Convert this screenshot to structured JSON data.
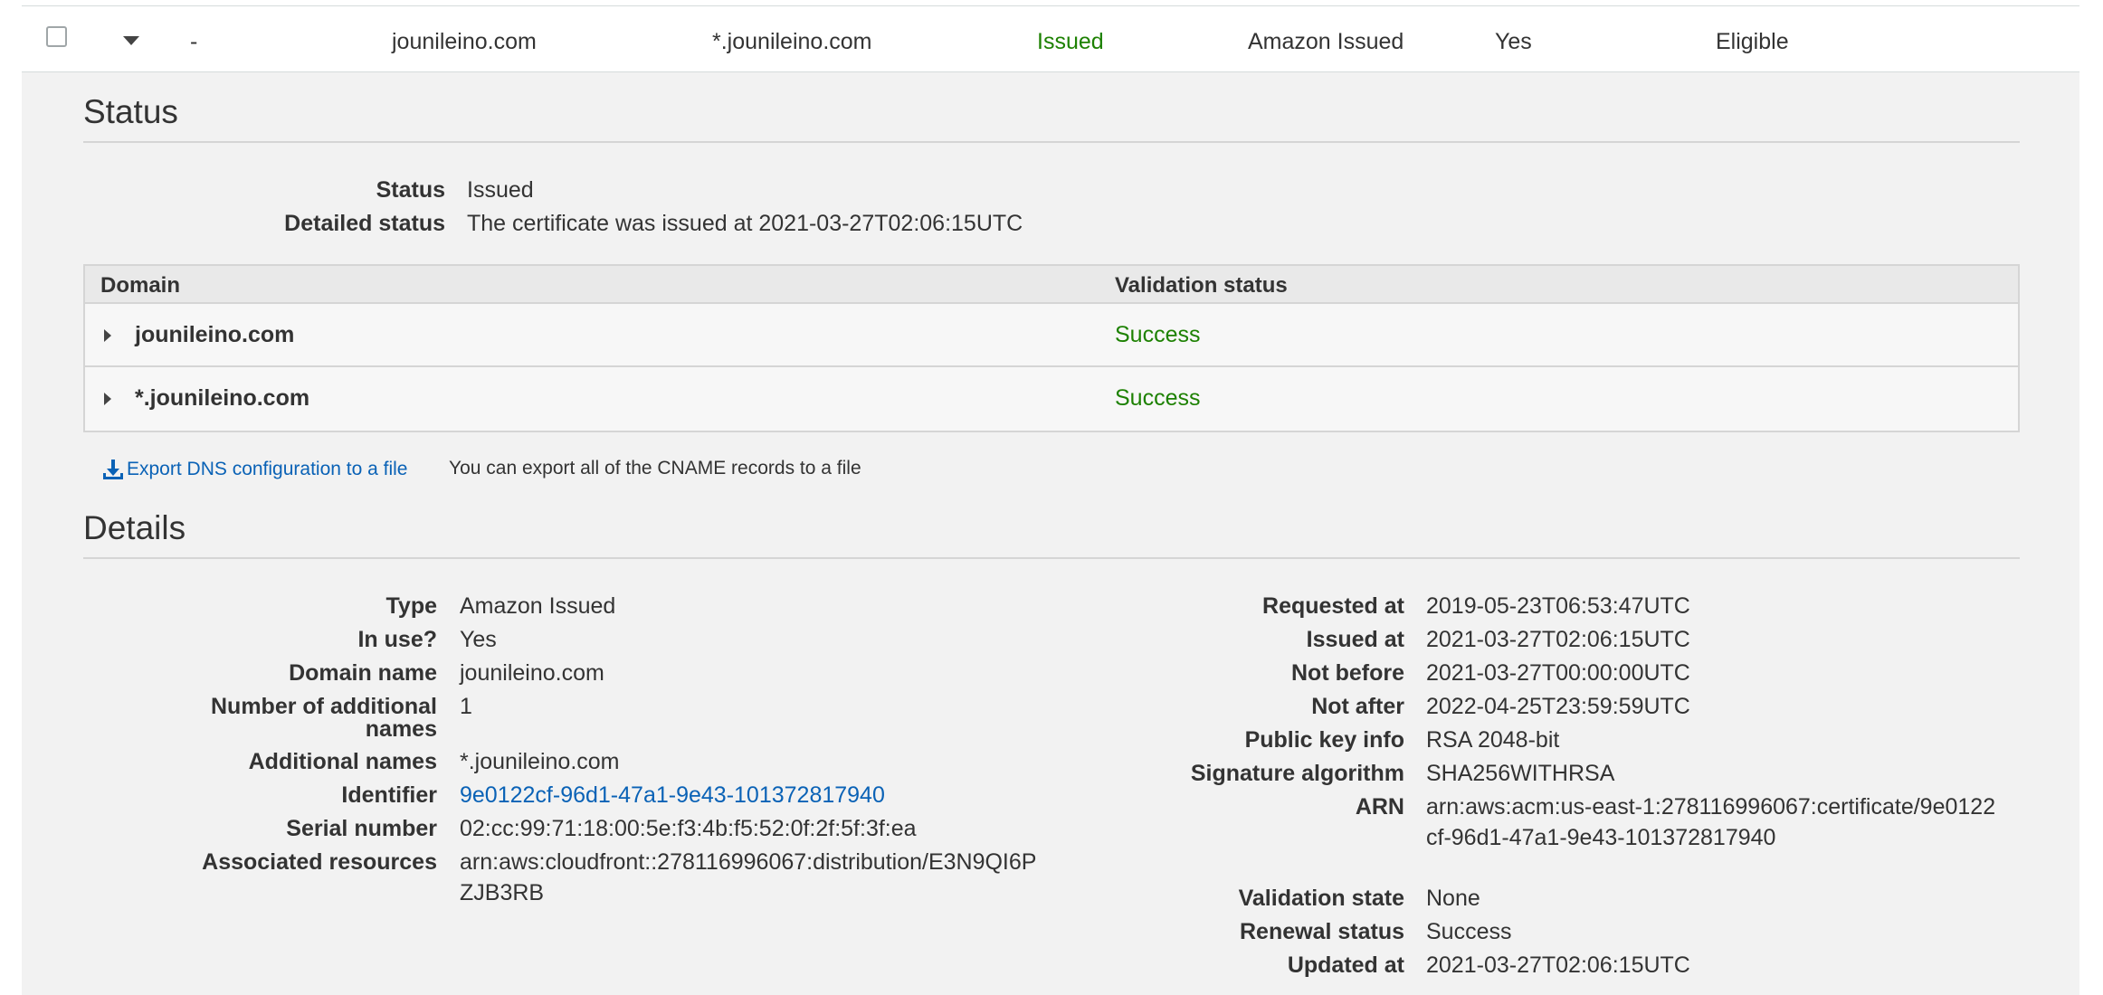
{
  "row": {
    "dash": "-",
    "domain": "jounileino.com",
    "additional": "*.jounileino.com",
    "status": "Issued",
    "type": "Amazon Issued",
    "in_use": "Yes",
    "renewal_eligibility": "Eligible"
  },
  "status_section": {
    "title": "Status",
    "status_label": "Status",
    "status_value": "Issued",
    "detailed_label": "Detailed status",
    "detailed_value": "The certificate was issued at 2021-03-27T02:06:15UTC"
  },
  "validation_table": {
    "headers": [
      "Domain",
      "Validation status"
    ],
    "rows": [
      {
        "domain": "jounileino.com",
        "status": "Success"
      },
      {
        "domain": "*.jounileino.com",
        "status": "Success"
      }
    ]
  },
  "export": {
    "link_label": "Export DNS configuration to a file",
    "note": "You can export all of the CNAME records to a file"
  },
  "details": {
    "title": "Details",
    "left": [
      {
        "label": "Type",
        "value": "Amazon Issued"
      },
      {
        "label": "In use?",
        "value": "Yes"
      },
      {
        "label": "Domain name",
        "value": "jounileino.com"
      },
      {
        "label": "Number of additional names",
        "value": "1"
      },
      {
        "label": "Additional names",
        "value": "*.jounileino.com"
      },
      {
        "label": "Identifier",
        "value": "9e0122cf-96d1-47a1-9e43-101372817940"
      },
      {
        "label": "Serial number",
        "value": "02:cc:99:71:18:00:5e:f3:4b:f5:52:0f:2f:5f:3f:ea"
      },
      {
        "label": "Associated resources",
        "value": "arn:aws:cloudfront::278116996067:distribution/E3N9QI6PZJB3RB"
      }
    ],
    "right": [
      {
        "label": "Requested at",
        "value": "2019-05-23T06:53:47UTC"
      },
      {
        "label": "Issued at",
        "value": "2021-03-27T02:06:15UTC"
      },
      {
        "label": "Not before",
        "value": "2021-03-27T00:00:00UTC"
      },
      {
        "label": "Not after",
        "value": "2022-04-25T23:59:59UTC"
      },
      {
        "label": "Public key info",
        "value": "RSA 2048-bit"
      },
      {
        "label": "Signature algorithm",
        "value": "SHA256WITHRSA"
      },
      {
        "label": "ARN",
        "value": "arn:aws:acm:us-east-1:278116996067:certificate/9e0122cf-96d1-47a1-9e43-101372817940"
      },
      {
        "label": "Validation state",
        "value": "None"
      },
      {
        "label": "Renewal status",
        "value": "Success"
      },
      {
        "label": "Updated at",
        "value": "2021-03-27T02:06:15UTC"
      }
    ]
  },
  "colors": {
    "success_green": "#1d8102",
    "link_blue": "#0a62b6",
    "panel_bg": "#f2f2f2"
  }
}
